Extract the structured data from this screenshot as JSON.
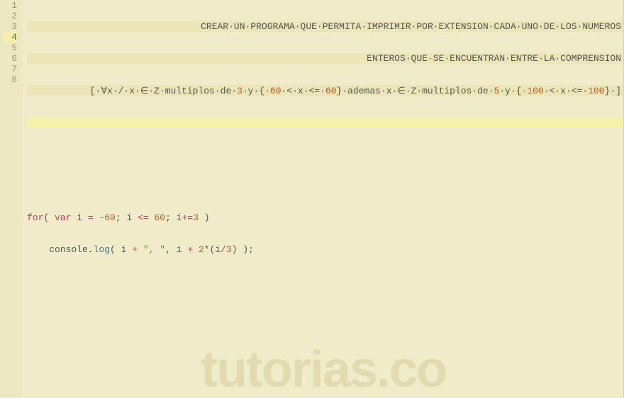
{
  "watermark": "tutorias.co",
  "gutter": {
    "lines": [
      "1",
      "2",
      "3",
      "4",
      "5",
      "6",
      "7",
      "8"
    ],
    "active_index": 3
  },
  "code": {
    "l1_text": "CREAR·UN·PROGRAMA·QUE·PERMITA·IMPRIMIR·POR·EXTENSION·CADA·UNO·DE·LOS·NUMEROS",
    "l2_text": "ENTEROS·QUE·SE·ENCUENTRAN·ENTRE·LA·COMPRENSION",
    "l3_pre": "[·",
    "l3_forall": "∀",
    "l3_a": "x·/·x·",
    "l3_in": "∈",
    "l3_b": "·Z·multiplos·de·",
    "l3_three": "3",
    "l3_c": "·y·{",
    "l3_neg60": "-60",
    "l3_lt1": "·<·x·<=·",
    "l3_pos60": "60",
    "l3_d": "}·ademas·x·",
    "l3_e": "·Z·multiplos·de·",
    "l3_five": "5",
    "l3_f": "·y·{",
    "l3_neg100": "-100",
    "l3_lt2": "·<·x·<=·",
    "l3_pos100": "100",
    "l3_g": "}·]",
    "l7_for": "for",
    "l7_paren_o": "( ",
    "l7_var": "var",
    "l7_i1": " i ",
    "l7_eq": "= ",
    "l7_neg60b": "-60",
    "l7_semi1": "; i ",
    "l7_lte": "<= ",
    "l7_pos60b": "60",
    "l7_semi2": "; i",
    "l7_pluseq": "+=",
    "l7_three_b": "3",
    "l7_paren_c": " )",
    "l8_indent": "    ",
    "l8_console": "console",
    "l8_dot": ".",
    "l8_log": "log",
    "l8_p1": "( i ",
    "l8_plus1": "+ ",
    "l8_str": "\", \"",
    "l8_comma": ", i ",
    "l8_plus2": "+ ",
    "l8_two": "2",
    "l8_mul": "*(i",
    "l8_div": "/",
    "l8_three_c": "3",
    "l8_end": ") );"
  }
}
